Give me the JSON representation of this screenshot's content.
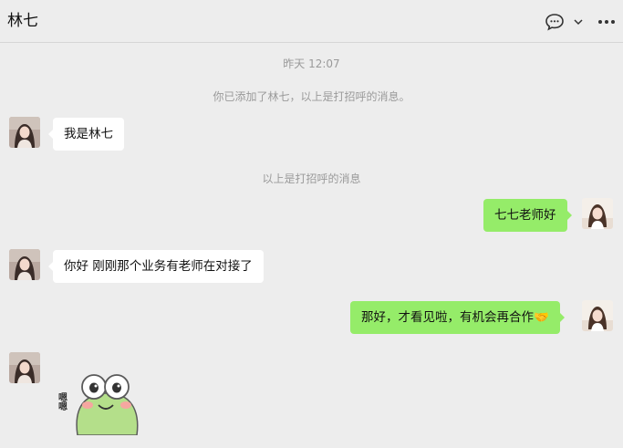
{
  "header": {
    "title": "林七",
    "icons": [
      "chat-bubble-icon",
      "chevron-down-icon",
      "more-icon"
    ]
  },
  "messages": {
    "timestamp": "昨天 12:07",
    "added_notice": "你已添加了林七，以上是打招呼的消息。",
    "m1": "我是林七",
    "greeting_notice": "以上是打招呼的消息",
    "m2": "七七老师好",
    "m3": "你好 刚刚那个业务有老师在对接了",
    "m4": "那好，才看见啦，有机会再合作🤝",
    "sticker_text": "嗯嗯"
  },
  "colors": {
    "background": "#ededed",
    "self_bubble": "#95ec69",
    "other_bubble": "#ffffff"
  }
}
